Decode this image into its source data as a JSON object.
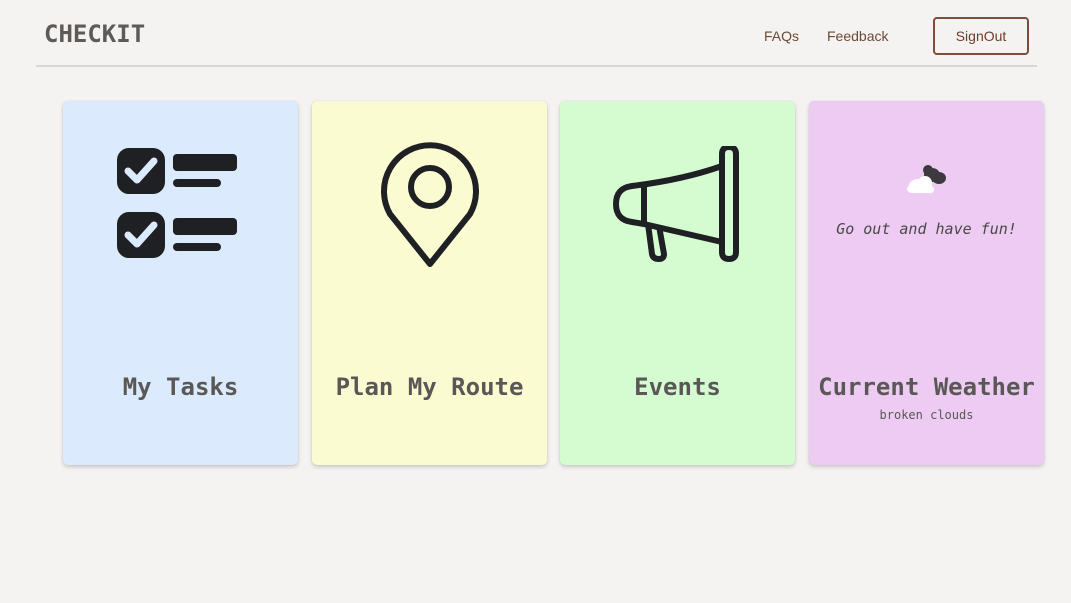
{
  "header": {
    "brand": "CHECKIT",
    "nav": {
      "faqs": "FAQs",
      "feedback": "Feedback"
    },
    "signout_label": "SignOut"
  },
  "cards": {
    "tasks": {
      "title": "My Tasks",
      "icon": "checklist-icon"
    },
    "route": {
      "title": "Plan My Route",
      "icon": "map-pin-icon"
    },
    "events": {
      "title": "Events",
      "icon": "megaphone-icon"
    },
    "weather": {
      "title": "Current Weather",
      "icon": "broken-clouds-icon",
      "message": "Go out and have fun!",
      "condition": "broken clouds"
    }
  },
  "colors": {
    "tasks_bg": "#dbeafc",
    "route_bg": "#fafbd0",
    "events_bg": "#d5fbd0",
    "weather_bg": "#edcbf2",
    "accent": "#7a4e3a"
  }
}
